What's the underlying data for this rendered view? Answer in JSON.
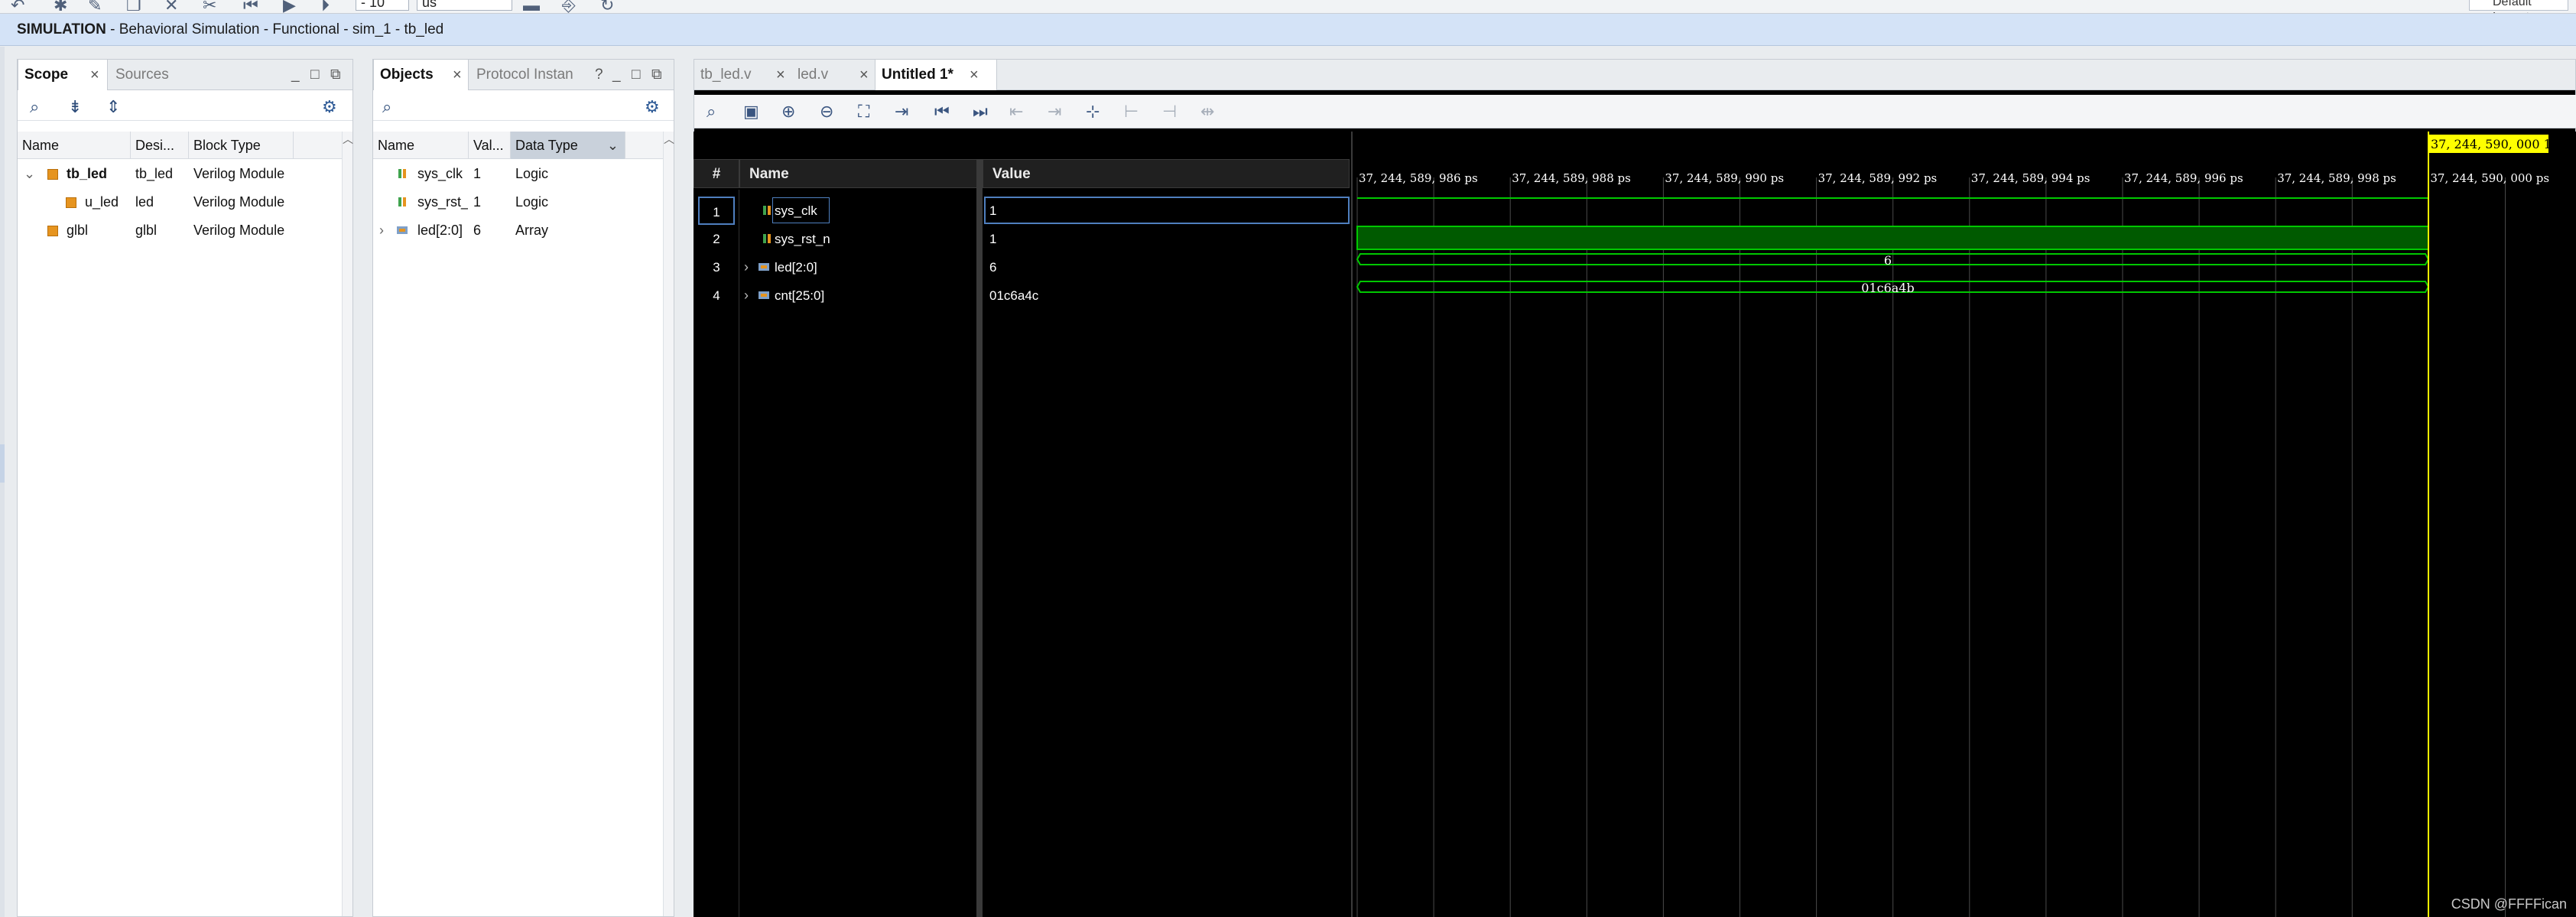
{
  "toolbar": {
    "field1_value": "- 10",
    "field2_value": "us",
    "layout_label": "Default Layout"
  },
  "sim_header": {
    "title_bold": "SIMULATION",
    "subtitle": " - Behavioral Simulation - Functional - sim_1 - tb_led"
  },
  "scope_panel": {
    "tabs": [
      {
        "label": "Scope",
        "active": true
      },
      {
        "label": "Sources",
        "active": false
      }
    ],
    "columns": [
      "Name",
      "Desi...",
      "Block Type"
    ],
    "rows": [
      {
        "name": "tb_led",
        "design": "tb_led",
        "block_type": "Verilog Module",
        "expandable": true,
        "bold": true
      },
      {
        "name": "u_led",
        "design": "led",
        "block_type": "Verilog Module",
        "expandable": false,
        "bold": false
      },
      {
        "name": "glbl",
        "design": "glbl",
        "block_type": "Verilog Module",
        "expandable": false,
        "bold": false
      }
    ]
  },
  "objects_panel": {
    "tabs": [
      {
        "label": "Objects",
        "active": true
      },
      {
        "label": "Protocol Instan",
        "active": false
      }
    ],
    "help": "?",
    "columns": [
      "Name",
      "Val...",
      "Data Type"
    ],
    "rows": [
      {
        "name": "sys_clk",
        "value": "1",
        "data_type": "Logic"
      },
      {
        "name": "sys_rst_",
        "value": "1",
        "data_type": "Logic"
      },
      {
        "name": "led[2:0]",
        "value": "6",
        "data_type": "Array"
      }
    ]
  },
  "wave_panel": {
    "tabs": [
      {
        "label": "tb_led.v",
        "active": false
      },
      {
        "label": "led.v",
        "active": false
      },
      {
        "label": "Untitled 1*",
        "active": true
      }
    ],
    "col_num": "#",
    "col_name": "Name",
    "col_value": "Value",
    "signals": [
      {
        "num": "1",
        "name": "sys_clk",
        "value": "1"
      },
      {
        "num": "2",
        "name": "sys_rst_n",
        "value": "1"
      },
      {
        "num": "3",
        "name": "led[2:0]",
        "value": "6"
      },
      {
        "num": "4",
        "name": "cnt[25:0]",
        "value": "01c6a4c"
      }
    ],
    "time_labels": [
      "37, 244, 589, 986 ps",
      "37, 244, 589, 988 ps",
      "37, 244, 589, 990 ps",
      "37, 244, 589, 992 ps",
      "37, 244, 589, 994 ps",
      "37, 244, 589, 996 ps",
      "37, 244, 589, 998 ps",
      "37, 244, 590, 000 ps"
    ],
    "cursor_label": "37, 244, 590, 000 1",
    "bus_values": {
      "led": "6",
      "cnt": "01c6a4b"
    },
    "colors": {
      "wave_green": "#00c800",
      "sys_rst_fill": "#005a00",
      "cursor_yellow": "#ffff00",
      "grid": "#4a4a4a"
    }
  },
  "watermark": "CSDN @FFFFican"
}
